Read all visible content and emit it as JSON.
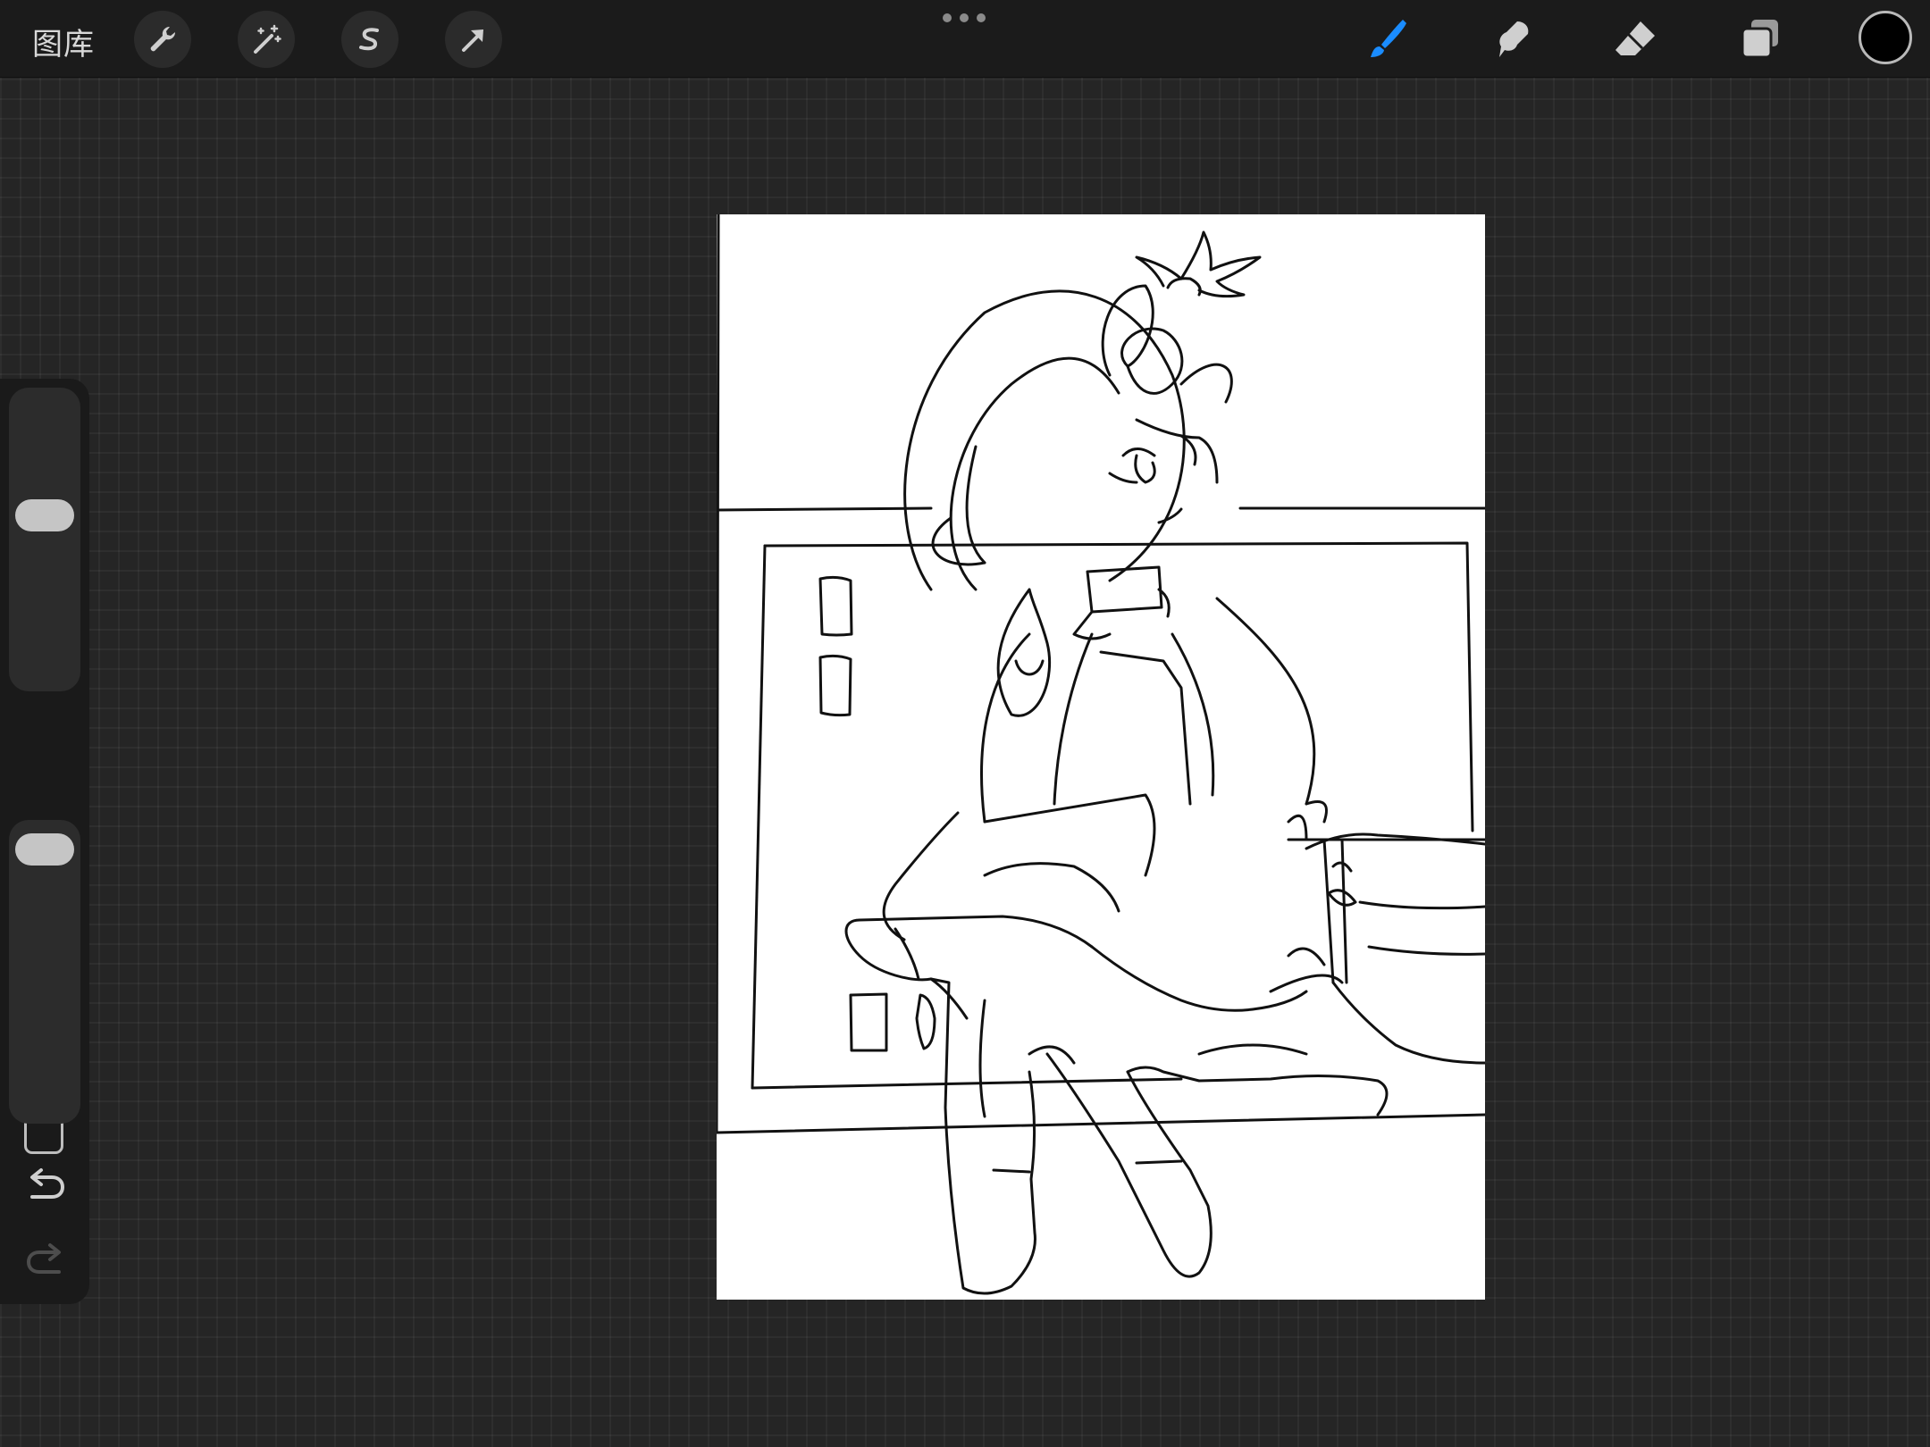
{
  "topbar": {
    "gallery_label": "图库",
    "left_tools": [
      "wrench-icon",
      "magic-wand-icon",
      "selection-s-icon",
      "transform-arrow-icon"
    ],
    "right_tools": [
      "brush-icon",
      "smudge-icon",
      "eraser-icon",
      "layers-icon"
    ],
    "active_tool": "brush",
    "current_color": "#000000"
  },
  "sidebar": {
    "brush_size_level": 0.59,
    "opacity_level": 0.95,
    "undo": "undo-icon",
    "redo": "redo-icon"
  },
  "colors": {
    "accent": "#1a8cff",
    "toolbar_bg": "#1b1b1b",
    "workspace_bg": "#252525",
    "canvas_bg": "#ffffff"
  }
}
